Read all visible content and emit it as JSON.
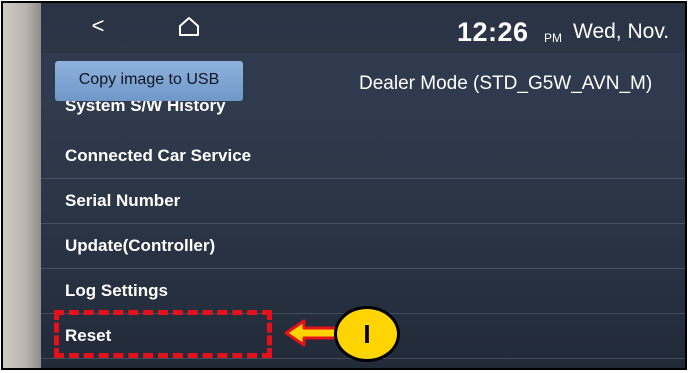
{
  "nav": {
    "back_glyph": "<",
    "back_icon": "chevron-left-icon",
    "home_icon": "home-icon"
  },
  "status": {
    "time": "12:26",
    "ampm": "PM",
    "date": "Wed, Nov."
  },
  "header": {
    "copy_button_label": "Copy image to USB",
    "title": "Dealer Mode (STD_G5W_AVN_M)"
  },
  "menu": {
    "partial_item": "System S/W History",
    "items": [
      "Connected Car Service",
      "Serial Number",
      "Update(Controller)",
      "Log Settings",
      "Reset"
    ]
  },
  "annotation": {
    "step_label": "I",
    "highlight_color": "#e4111a",
    "badge_color": "#ffd400",
    "arrow_icon": "arrow-left-icon"
  }
}
